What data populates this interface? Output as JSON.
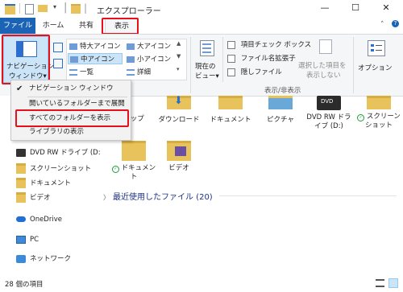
{
  "window": {
    "title": "エクスプローラー",
    "minimize": "—",
    "maximize": "☐",
    "close": "✕"
  },
  "tabs": {
    "file": "ファイル",
    "home": "ホーム",
    "share": "共有",
    "view": "表示"
  },
  "ribbon": {
    "nav_pane_line1": "ナビゲーション",
    "nav_pane_line2": "ウィンドウ▾",
    "layout": {
      "extra_large": "特大アイコン",
      "large": "大アイコン",
      "medium": "中アイコン",
      "small": "小アイコン",
      "list": "一覧",
      "details": "詳細",
      "group_title": "レイアウト",
      "group_title_visible": "ウト"
    },
    "current_view_line1": "現在の",
    "current_view_line2": "ビュー▾",
    "show_hide": {
      "item_checkboxes": "項目チェック ボックス",
      "extensions": "ファイル名拡張子",
      "hidden_items": "隠しファイル",
      "hide_selected_line1": "選択した項目を",
      "hide_selected_line2": "表示しない",
      "group_title": "表示/非表示"
    },
    "options": "オプション"
  },
  "dropdown": {
    "items": [
      {
        "label": "ナビゲーション ウィンドウ",
        "checked": true
      },
      {
        "label": "開いているフォルダーまで展開",
        "checked": false
      },
      {
        "label": "すべてのフォルダーを表示",
        "checked": false
      },
      {
        "label": "ライブラリの表示",
        "checked": false
      }
    ]
  },
  "nav": {
    "dvd": "DVD RW ドライブ (D:",
    "screenshots": "スクリーンショット",
    "documents": "ドキュメント",
    "videos": "ビデオ",
    "onedrive": "OneDrive",
    "pc": "PC",
    "network": "ネットワーク"
  },
  "files": {
    "desktop": "トップ",
    "downloads": "ダウンロード",
    "documents": "ドキュメント",
    "pictures": "ピクチャ",
    "dvd_line1": "DVD RW ドラ",
    "dvd_line2": "イブ (D:)",
    "screenshots_line1": "スクリーン",
    "screenshots_line2": "ショット",
    "doc2_line1": "ドキュメン",
    "doc2_line2": "ト",
    "video": "ビデオ",
    "dvd_badge": "DVD"
  },
  "recent": {
    "label": "最近使用したファイル (20)",
    "chevron": "〉"
  },
  "status": {
    "count": "28 個の項目"
  },
  "colors": {
    "accent": "#1a63b5",
    "highlight": "#e8101c",
    "folder": "#e8c25a"
  }
}
